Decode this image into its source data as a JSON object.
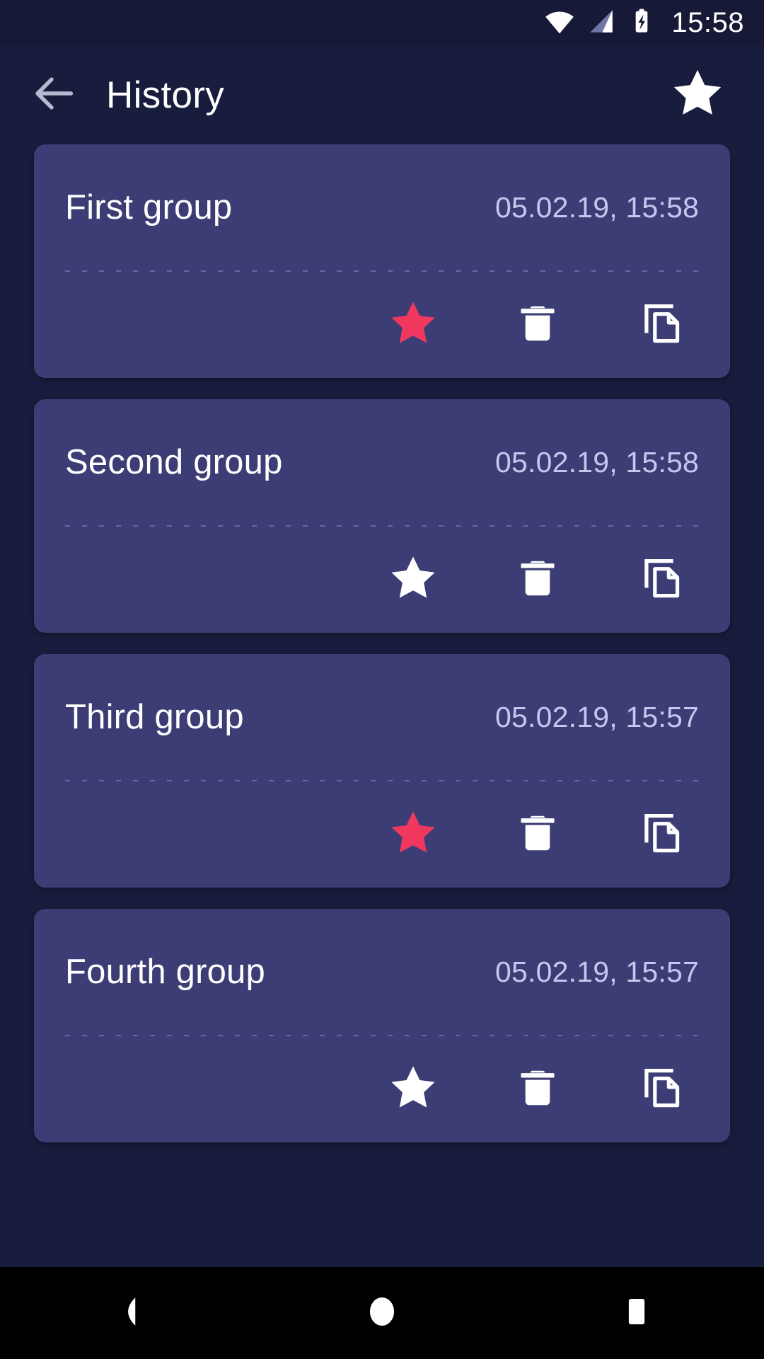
{
  "status_bar": {
    "time": "15:58",
    "icons": [
      "wifi-icon",
      "cellular-signal-icon",
      "battery-charging-icon"
    ]
  },
  "app_bar": {
    "back_icon": "arrow-back-icon",
    "title": "History",
    "favorites_icon": "star-filled-icon"
  },
  "colors": {
    "background": "#181d3d",
    "status_bar": "#161a36",
    "card": "#3b3d74",
    "accent_favorite": "#f0385f",
    "icon_white": "#ffffff",
    "date_text": "#c5c7ef",
    "divider": "#6b6fae",
    "nav_bar": "#000000"
  },
  "history": {
    "actions": {
      "favorite_label": "star-icon",
      "delete_label": "trash-icon",
      "copy_label": "copy-icon"
    },
    "items": [
      {
        "title": "First group",
        "date": "05.02.19, 15:58",
        "favorited": true
      },
      {
        "title": "Second group",
        "date": "05.02.19, 15:58",
        "favorited": false
      },
      {
        "title": "Third group",
        "date": "05.02.19, 15:57",
        "favorited": true
      },
      {
        "title": "Fourth group",
        "date": "05.02.19, 15:57",
        "favorited": false
      }
    ]
  },
  "nav_bar": {
    "back": "nav-back-icon",
    "home": "nav-home-icon",
    "recents": "nav-recents-icon"
  }
}
